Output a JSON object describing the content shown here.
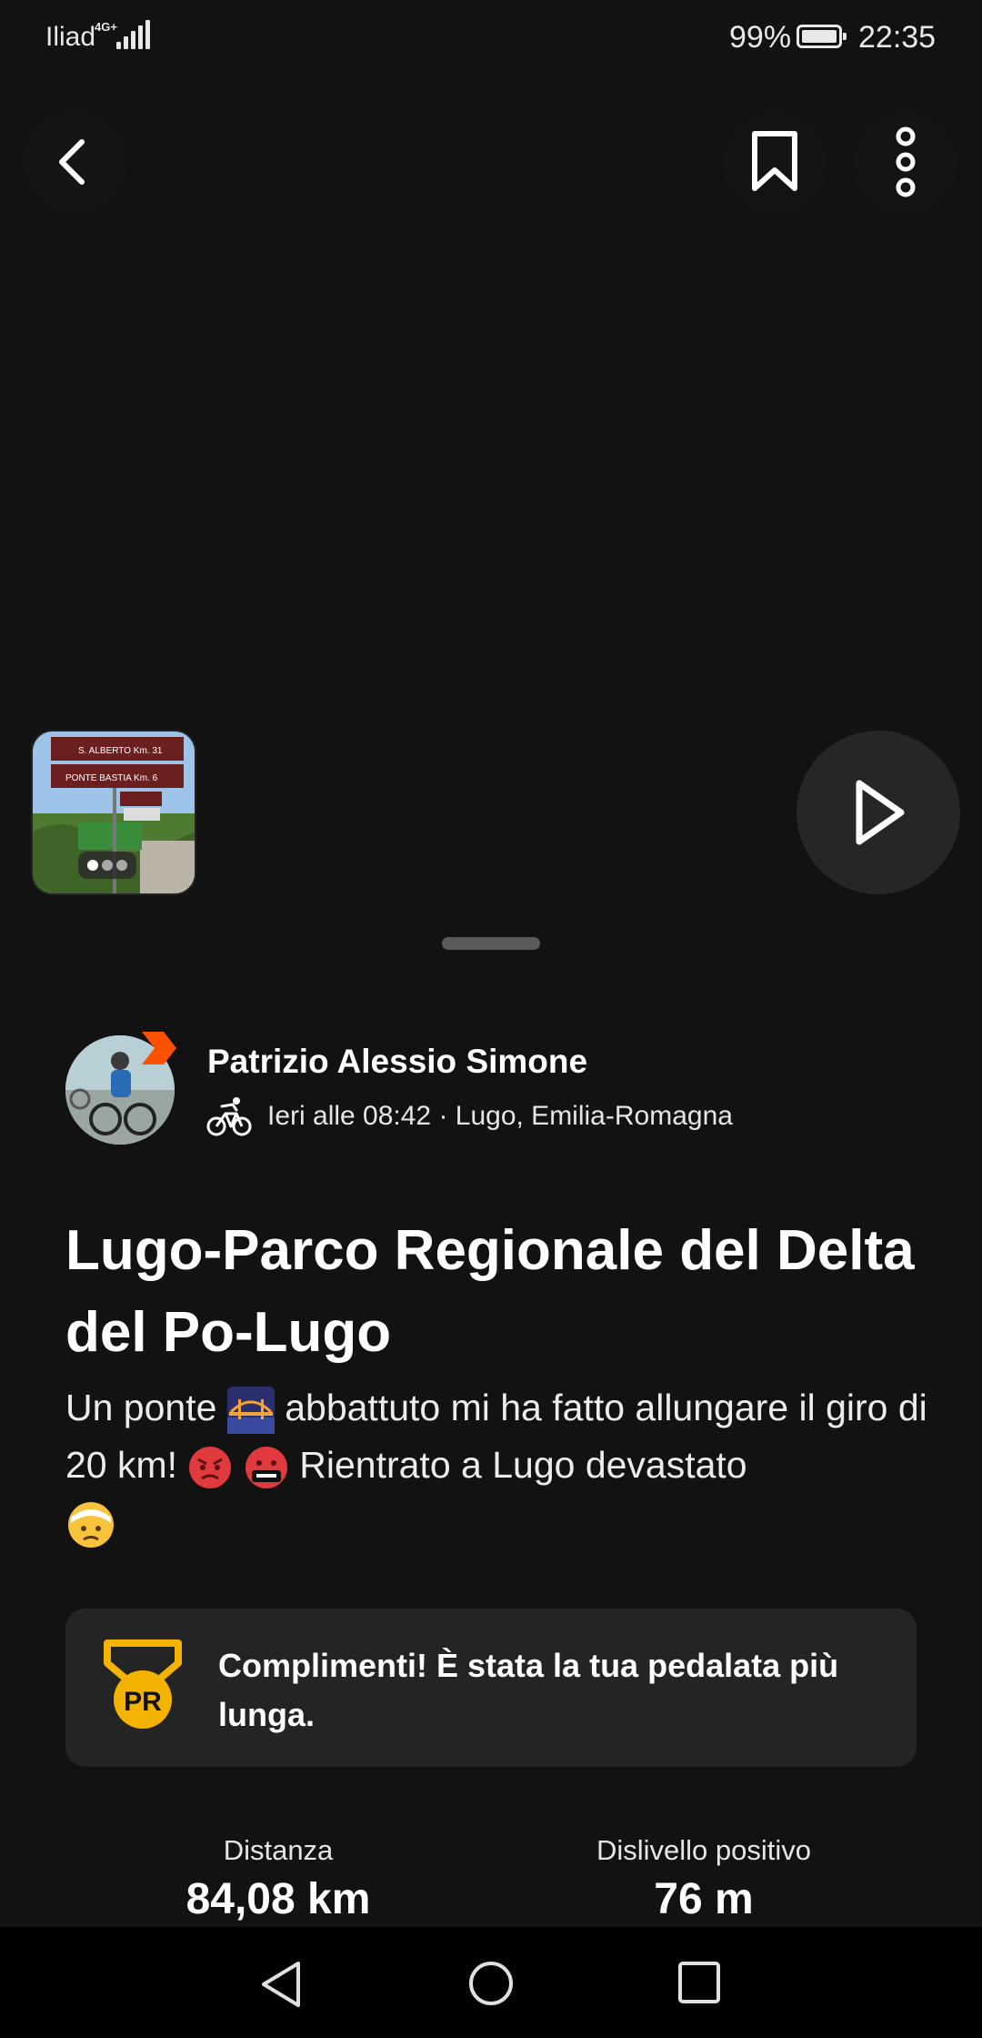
{
  "status_bar": {
    "carrier": "Iliad",
    "network": "4G+",
    "battery": "99%",
    "time": "22:35"
  },
  "icons": {
    "back": "back-icon",
    "save": "bookmark-icon",
    "more": "more-vertical-icon",
    "play": "play-icon",
    "activity": "bike-icon",
    "pr": "pr-medal-icon"
  },
  "athlete": {
    "name": "Patrizio Alessio Simone",
    "meta": "Ieri alle 08:42 · Lugo, Emilia-Romagna"
  },
  "activity": {
    "title": "Lugo-Parco Regionale del Delta del Po-Lugo",
    "description_part1": "Un ponte",
    "description_part2": "abbattuto mi ha fatto allungare il giro di 20 km!",
    "description_part3": "Rientrato a Lugo devastato"
  },
  "achievement": {
    "text": "Complimenti! È stata la tua pedalata più lunga."
  },
  "stats": [
    {
      "label": "Distanza",
      "value": "84,08 km"
    },
    {
      "label": "Dislivello positivo",
      "value": "76 m"
    }
  ],
  "photo_thumbnail": {
    "sign_line1": "S. ALBERTO Km. 31",
    "sign_line2": "PONTE BASTIA Km. 6"
  },
  "colors": {
    "background": "#121212",
    "card": "#242424",
    "accent": "#fc5200",
    "pr_gold": "#f5b301"
  }
}
